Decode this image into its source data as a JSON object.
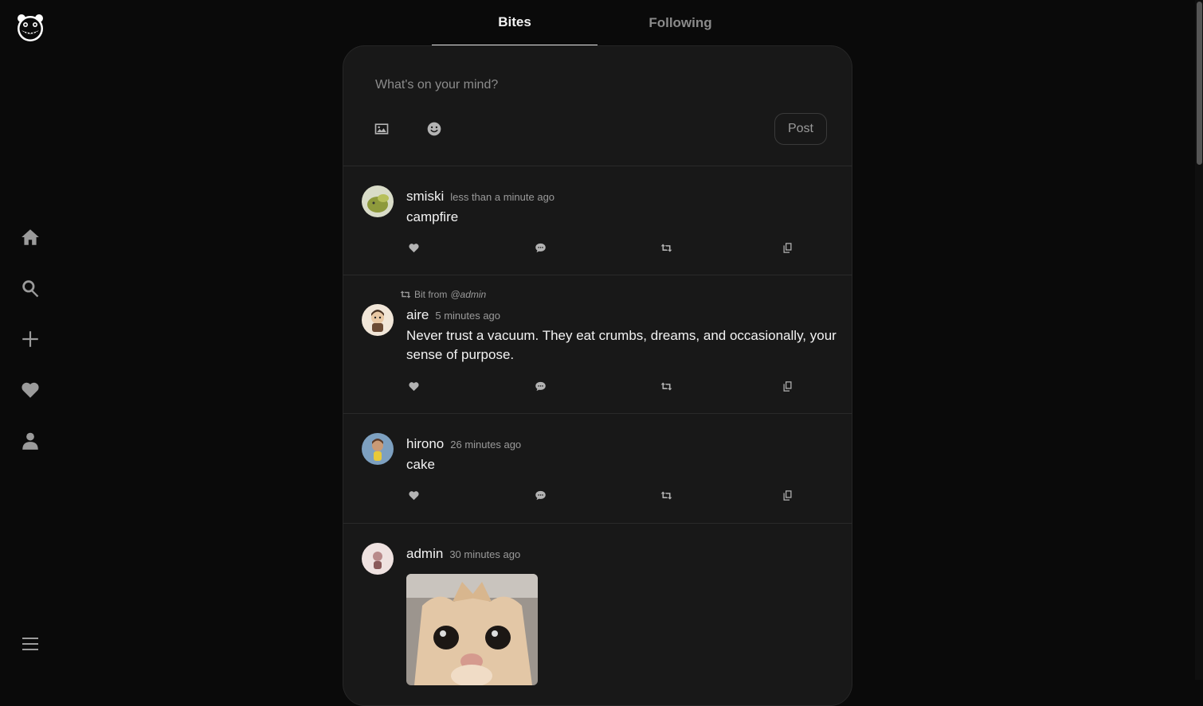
{
  "app": {
    "logo_icon": "bear-face-logo",
    "accent": "#f3f3f3",
    "background": "#0a0a0a"
  },
  "sidebar": {
    "items": [
      {
        "icon": "home-icon"
      },
      {
        "icon": "search-icon"
      },
      {
        "icon": "plus-icon"
      },
      {
        "icon": "heart-icon"
      },
      {
        "icon": "user-icon"
      }
    ],
    "menu_icon": "hamburger-menu-icon"
  },
  "tabs": [
    {
      "label": "Bites",
      "active": true
    },
    {
      "label": "Following",
      "active": false
    }
  ],
  "composer": {
    "placeholder": "What's on your mind?",
    "image_icon": "image-icon",
    "emoji_icon": "smiley-icon",
    "post_label": "Post"
  },
  "posts": [
    {
      "username": "smiski",
      "time": "less than a minute ago",
      "text": "campfire",
      "avatar": "green-figure-avatar"
    },
    {
      "repost_prefix": "Bit from",
      "repost_user": "@admin",
      "username": "aire",
      "time": "5 minutes ago",
      "text": "Never trust a vacuum. They eat crumbs, dreams, and occasionally, your sense of purpose.",
      "avatar": "doll-avatar"
    },
    {
      "username": "hirono",
      "time": "26 minutes ago",
      "text": "cake",
      "avatar": "blue-figure-avatar"
    },
    {
      "username": "admin",
      "time": "30 minutes ago",
      "image": "cat-photo",
      "avatar": "pink-figure-avatar"
    }
  ]
}
